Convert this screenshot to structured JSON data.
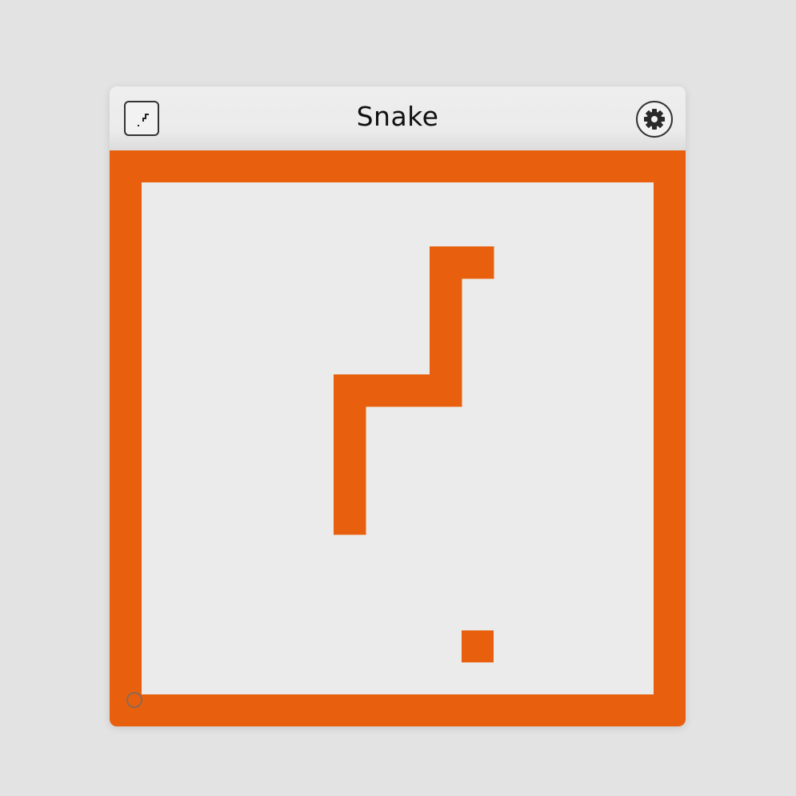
{
  "window": {
    "title": "Snake"
  },
  "toolbar": {
    "left_button_icon": "snake-preview-icon",
    "right_button_icon": "gear-icon"
  },
  "game": {
    "grid_size": 16,
    "wall_color": "#e8600e",
    "floor_color": "#ebebeb",
    "snake_color": "#e8600e",
    "food_color": "#e8600e",
    "snake": [
      [
        10,
        2
      ],
      [
        9,
        2
      ],
      [
        9,
        3
      ],
      [
        9,
        4
      ],
      [
        9,
        5
      ],
      [
        9,
        6
      ],
      [
        8,
        6
      ],
      [
        7,
        6
      ],
      [
        6,
        6
      ],
      [
        6,
        7
      ],
      [
        6,
        8
      ],
      [
        6,
        9
      ],
      [
        6,
        10
      ]
    ],
    "food": [
      10,
      14
    ],
    "corner_indicator_icon": "ring-icon"
  }
}
